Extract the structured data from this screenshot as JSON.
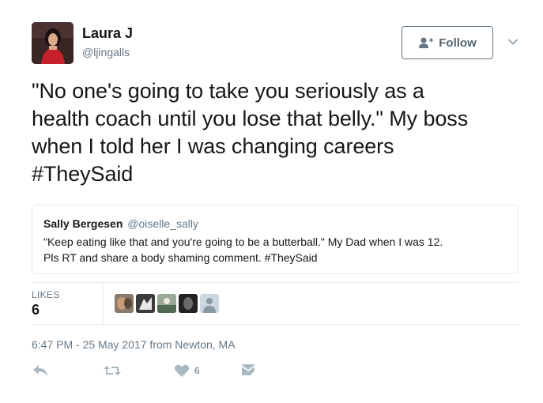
{
  "author": {
    "name": "Laura J",
    "handle": "@ljingalls",
    "avatar_icon": "profile-photo"
  },
  "follow_button": {
    "label": "Follow",
    "icon": "add-user-icon"
  },
  "menu": {
    "icon": "chevron-down-icon"
  },
  "tweet": {
    "lines": [
      "\"No one's going to take you seriously as a",
      "health coach until you lose that belly.\" My boss",
      "when I told her I was changing careers",
      "#TheySaid"
    ]
  },
  "quote": {
    "name": "Sally Bergesen",
    "handle": "@oiselle_sally",
    "lines": [
      "\"Keep eating like that and you're going to be a butterball.\" My Dad when I was 12.",
      "Pls RT and share a body shaming comment. #TheySaid"
    ]
  },
  "likes": {
    "label": "LIKES",
    "count": "6",
    "likers": [
      "liker-1",
      "liker-2",
      "liker-3",
      "liker-4",
      "liker-default"
    ]
  },
  "timestamp": "6:47 PM - 25 May 2017 from Newton, MA",
  "actions": {
    "reply_icon": "reply-icon",
    "retweet_icon": "retweet-icon",
    "like_icon": "heart-icon",
    "like_count": "6",
    "message_icon": "direct-message-icon"
  },
  "colors": {
    "text": "#14171a",
    "secondary": "#657786",
    "border": "#e1e8ed",
    "action_gray": "#aab8c2"
  }
}
